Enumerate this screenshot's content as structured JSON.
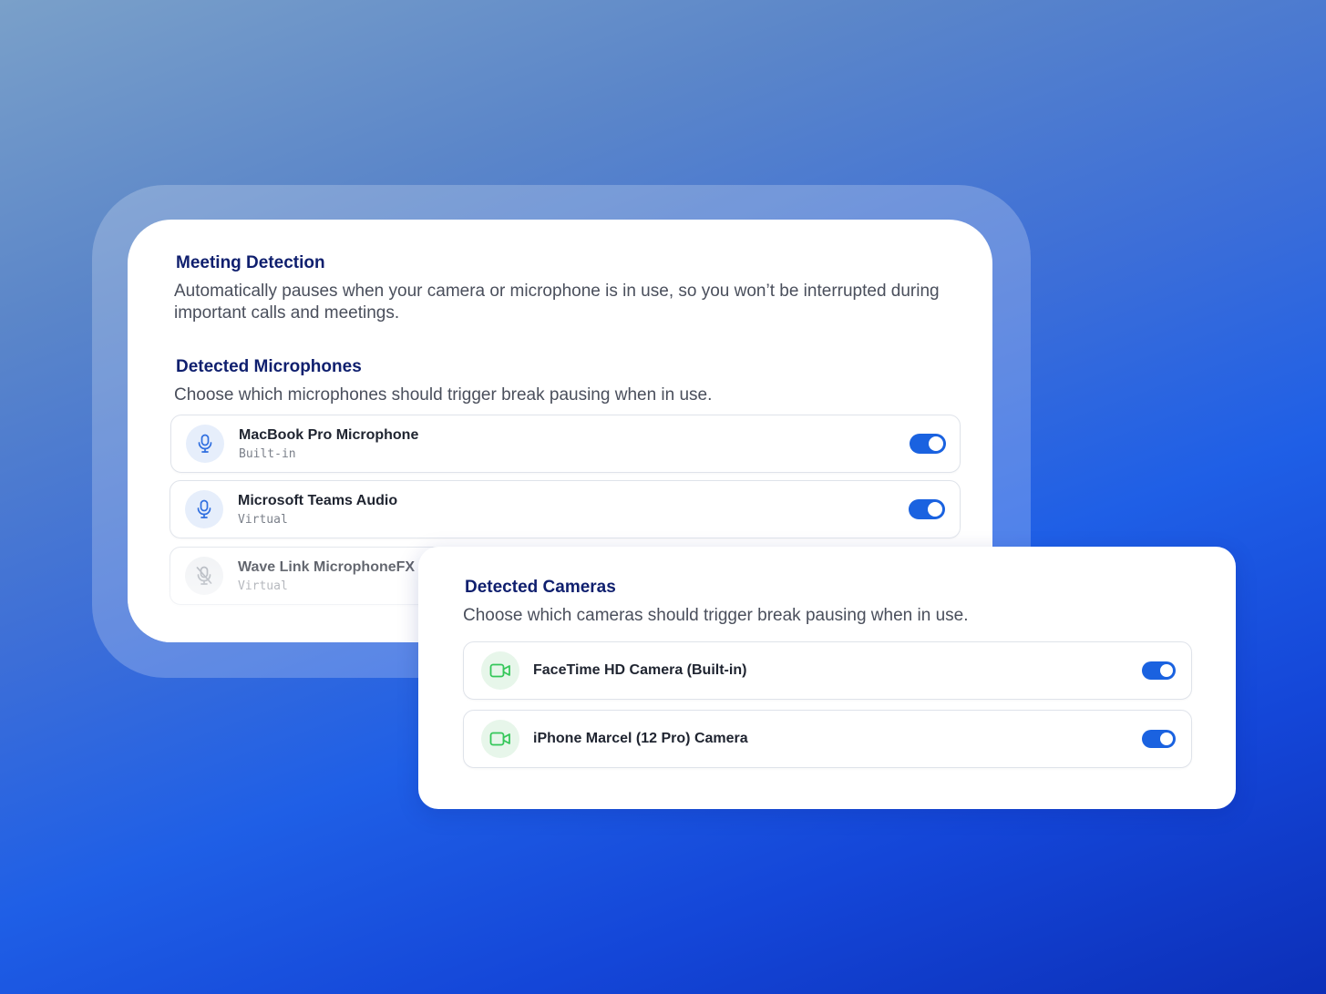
{
  "meeting": {
    "title": "Meeting Detection",
    "description_line1": "Automatically pauses when your camera or microphone is in use, so you won’t be interrupted during",
    "description_line2": "important calls and meetings."
  },
  "microphones": {
    "title": "Detected Microphones",
    "description": "Choose which microphones should trigger break pausing when in use.",
    "items": [
      {
        "name": "MacBook Pro Microphone",
        "type": "Built-in",
        "enabled": true,
        "icon": "microphone-icon"
      },
      {
        "name": "Microsoft Teams Audio",
        "type": "Virtual",
        "enabled": true,
        "icon": "microphone-icon"
      },
      {
        "name": "Wave Link MicrophoneFX",
        "type": "Virtual",
        "enabled": false,
        "icon": "microphone-off-icon"
      }
    ]
  },
  "cameras": {
    "title": "Detected Cameras",
    "description": "Choose which cameras should trigger break pausing when in use.",
    "items": [
      {
        "name": "FaceTime HD Camera (Built-in)",
        "enabled": true,
        "icon": "video-camera-icon"
      },
      {
        "name": "iPhone Marcel (12 Pro) Camera",
        "enabled": true,
        "icon": "video-camera-icon"
      }
    ]
  },
  "colors": {
    "accent": "#1a62e0",
    "heading": "#0f1f6e",
    "camera_icon": "#34c759",
    "mic_icon": "#2f6fe0"
  }
}
